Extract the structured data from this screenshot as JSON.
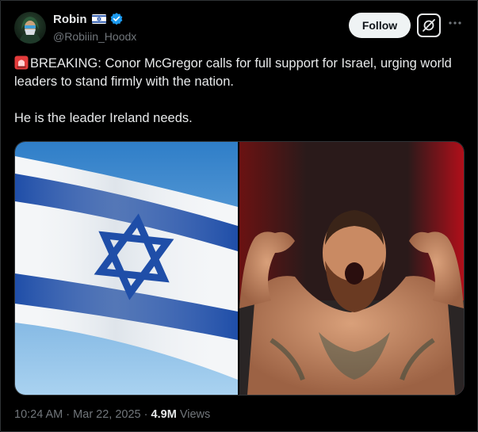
{
  "author": {
    "display_name": "Robin",
    "handle": "@Robiiin_Hoodx",
    "flag": "israel-flag-emoji",
    "verified": true
  },
  "actions": {
    "follow_label": "Follow",
    "grok_icon": "grok-icon",
    "more_icon": "more-icon"
  },
  "tweet": {
    "emoji": "police-car-light",
    "line1": "BREAKING: Conor McGregor calls for full support for Israel, urging world leaders to stand firmly with the nation.",
    "line2": "He is the leader Ireland needs."
  },
  "media": [
    {
      "kind": "israel-flag-photo"
    },
    {
      "kind": "fighter-flexing-photo"
    }
  ],
  "meta": {
    "time": "10:24 AM",
    "sep1": "·",
    "date": "Mar 22, 2025",
    "sep2": "·",
    "views_count": "4.9M",
    "views_label": "Views"
  },
  "colors": {
    "background": "#000000",
    "text": "#e7e9ea",
    "muted": "#71767b",
    "verified": "#1d9bf0",
    "flag_blue": "#1f4ea8"
  }
}
